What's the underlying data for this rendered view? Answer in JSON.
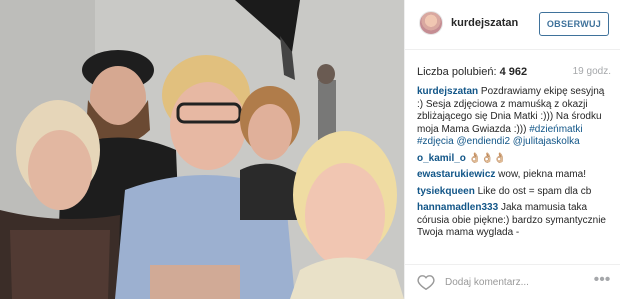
{
  "post": {
    "username": "kurdejszatan",
    "follow_label": "OBSERWUJ",
    "likes_label": "Liczba polubień:",
    "likes_count": "4 962",
    "time": "19 godz.",
    "caption": {
      "user": "kurdejszatan",
      "text": "Pozdrawiamy ekipę sesyjną :) Sesja zdjęciowa z mamuśką z okazji zbliżającego się Dnia Matki :))) Na środku moja Mama Gwiazda :)))",
      "tags": [
        "#dzieńmatki",
        "#zdjęcia",
        "@endiendi2",
        "@julitajaskolka"
      ]
    }
  },
  "comments": [
    {
      "user": "o_kamil_o",
      "text": "👌🏼👌🏼👌🏼"
    },
    {
      "user": "ewastarukiewicz",
      "text": "wow, piekna mama!"
    },
    {
      "user": "tysiekqueen",
      "text": "Like do ost = spam dla cb"
    },
    {
      "user": "hannamadlen333",
      "text": "Jaka mamusia taka córusia obie piękne:) bardzo symantycznie Twoja mama wyglada -"
    }
  ],
  "footer": {
    "comment_placeholder": "Dodaj komentarz...",
    "more_symbol": "•••"
  },
  "colors": {
    "link_blue": "#125688",
    "button_blue": "#3f729b",
    "muted_gray": "#a5a7aa"
  },
  "icons": [
    "heart-icon",
    "more-options-icon"
  ]
}
